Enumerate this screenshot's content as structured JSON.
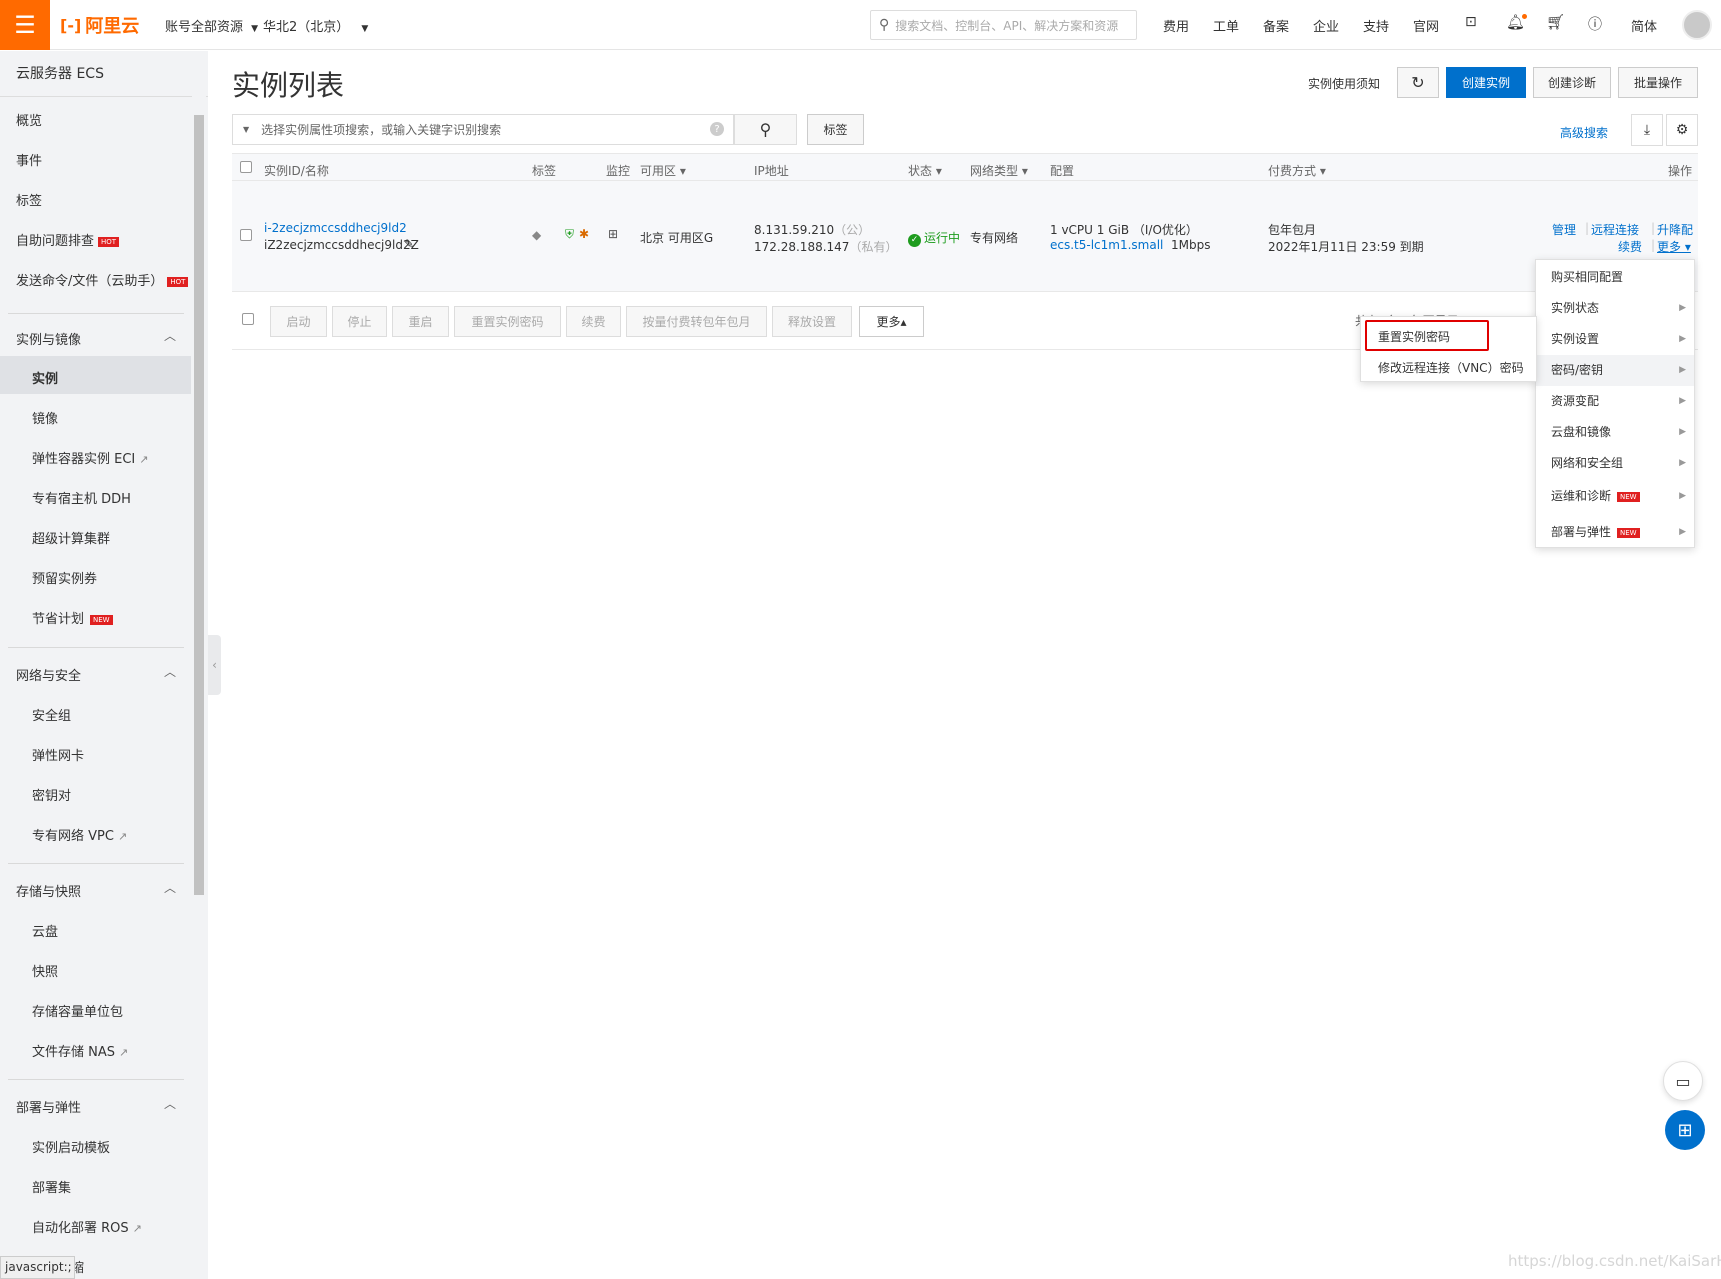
{
  "topbar": {
    "logo_text": "阿里云",
    "account_resources": "账号全部资源",
    "region": "华北2（北京）",
    "search_placeholder": "搜索文档、控制台、API、解决方案和资源",
    "nav": [
      "费用",
      "工单",
      "备案",
      "企业",
      "支持",
      "官网"
    ],
    "lang": "简体"
  },
  "sidebar": {
    "title": "云服务器 ECS",
    "top_items": [
      "概览",
      "事件",
      "标签",
      "自助问题排查",
      "发送命令/文件（云助手）"
    ],
    "hot_badge": "HOT",
    "new_badge": "NEW",
    "groups": [
      {
        "label": "实例与镜像",
        "items": [
          "实例",
          "镜像",
          "弹性容器实例 ECI",
          "专有宿主机 DDH",
          "超级计算集群",
          "预留实例券",
          "节省计划"
        ]
      },
      {
        "label": "网络与安全",
        "items": [
          "安全组",
          "弹性网卡",
          "密钥对",
          "专有网络 VPC"
        ]
      },
      {
        "label": "存储与快照",
        "items": [
          "云盘",
          "快照",
          "存储容量单位包",
          "文件存储 NAS"
        ]
      },
      {
        "label": "部署与弹性",
        "items": [
          "实例启动模板",
          "部署集",
          "自动化部署 ROS",
          "弹性伸缩"
        ]
      }
    ],
    "status_bar": "javascript:;"
  },
  "header": {
    "title": "实例列表",
    "notice_link": "实例使用须知",
    "refresh": "↻",
    "create_instance": "创建实例",
    "create_diagnosis": "创建诊断",
    "batch_ops": "批量操作"
  },
  "search": {
    "placeholder": "选择实例属性项搜索，或输入关键字识别搜索",
    "tag_button": "标签",
    "advanced": "高级搜索"
  },
  "table": {
    "columns": [
      "实例ID/名称",
      "标签",
      "监控",
      "可用区",
      "IP地址",
      "状态",
      "网络类型",
      "配置",
      "付费方式",
      "操作"
    ],
    "row": {
      "instance_id": "i-2zecjzmccsddhecj9ld2",
      "instance_name": "iZ2zecjzmccsddhecj9ld2Z",
      "zone": "北京 可用区G",
      "ip_public": "8.131.59.210",
      "ip_public_tag": "（公）",
      "ip_private": "172.28.188.147",
      "ip_private_tag": "（私有）",
      "status": "运行中",
      "network": "专有网络",
      "config_line1": "1 vCPU 1 GiB （I/O优化）",
      "config_spec": "ecs.t5-lc1m1.small",
      "config_bw": "1Mbps",
      "billing_type": "包年包月",
      "billing_expire": "2022年1月11日 23:59 到期",
      "op_manage": "管理",
      "op_remote": "远程连接",
      "op_upgrade": "升降配",
      "op_renew": "续费",
      "op_more": "更多"
    }
  },
  "bottom_actions": {
    "buttons": [
      "启动",
      "停止",
      "重启",
      "重置实例密码",
      "续费",
      "按量付费转包年包月",
      "释放设置",
      "更多▴"
    ],
    "pager": "共有1条，每页显示"
  },
  "dropdown": {
    "items": [
      "购买相同配置",
      "实例状态",
      "实例设置",
      "密码/密钥",
      "资源变配",
      "云盘和镜像",
      "网络和安全组",
      "运维和诊断",
      "部署与弹性"
    ]
  },
  "submenu": {
    "items": [
      "重置实例密码",
      "修改远程连接（VNC）密码"
    ]
  },
  "watermark": "https://blog.csdn.net/KaiSarH"
}
